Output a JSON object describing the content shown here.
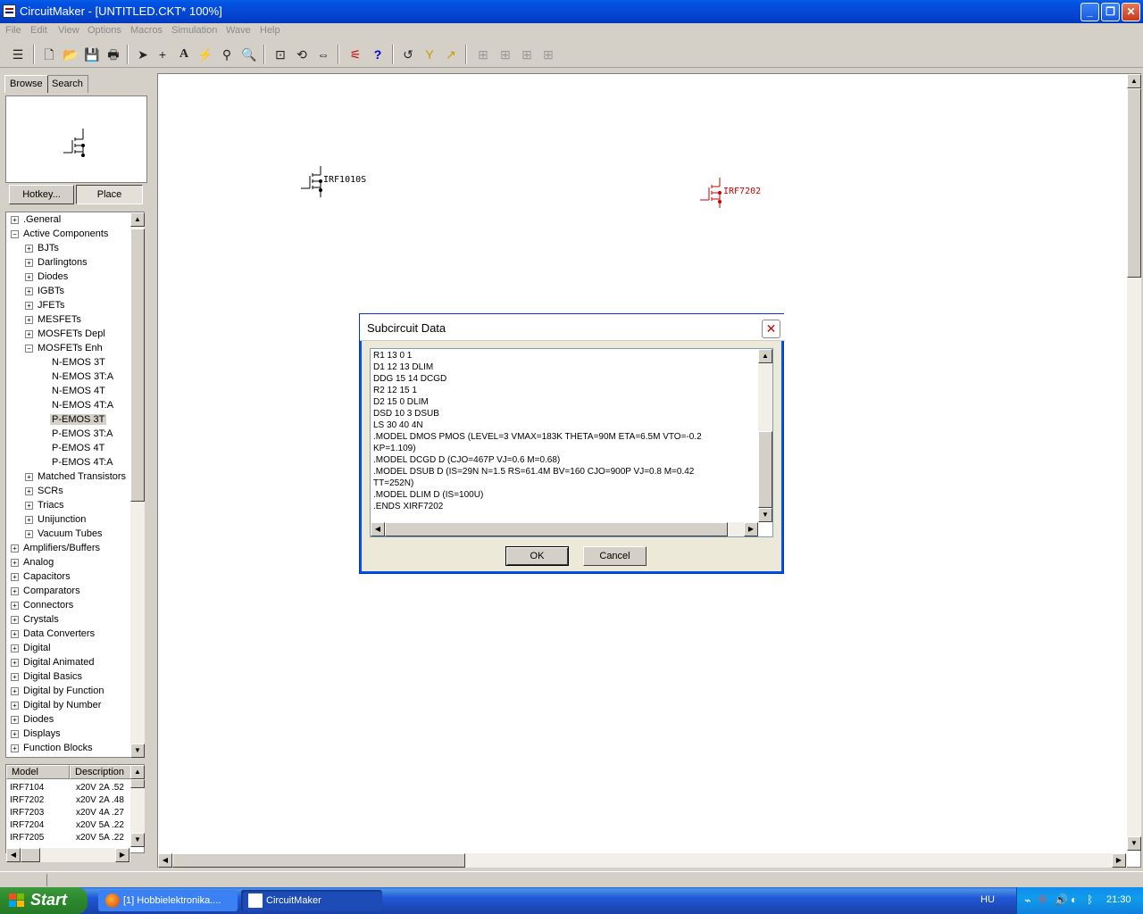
{
  "window": {
    "title": "CircuitMaker - [UNTITLED.CKT* 100%]"
  },
  "menu": [
    "File",
    "Edit",
    "View",
    "Options",
    "Macros",
    "Simulation",
    "Wave",
    "Help"
  ],
  "tabs": {
    "browse": "Browse",
    "search": "Search"
  },
  "buttons": {
    "hotkey": "Hotkey...",
    "place": "Place"
  },
  "tree": [
    {
      "label": ".General",
      "level": 0,
      "exp": "+"
    },
    {
      "label": "Active Components",
      "level": 0,
      "exp": "−"
    },
    {
      "label": "BJTs",
      "level": 1,
      "exp": "+"
    },
    {
      "label": "Darlingtons",
      "level": 1,
      "exp": "+"
    },
    {
      "label": "Diodes",
      "level": 1,
      "exp": "+"
    },
    {
      "label": "IGBTs",
      "level": 1,
      "exp": "+"
    },
    {
      "label": "JFETs",
      "level": 1,
      "exp": "+"
    },
    {
      "label": "MESFETs",
      "level": 1,
      "exp": "+"
    },
    {
      "label": "MOSFETs Depl",
      "level": 1,
      "exp": "+"
    },
    {
      "label": "MOSFETs Enh",
      "level": 1,
      "exp": "−"
    },
    {
      "label": "N-EMOS 3T",
      "level": 2,
      "exp": ""
    },
    {
      "label": "N-EMOS 3T:A",
      "level": 2,
      "exp": ""
    },
    {
      "label": "N-EMOS 4T",
      "level": 2,
      "exp": ""
    },
    {
      "label": "N-EMOS 4T:A",
      "level": 2,
      "exp": ""
    },
    {
      "label": "P-EMOS 3T",
      "level": 2,
      "exp": "",
      "selected": true
    },
    {
      "label": "P-EMOS 3T:A",
      "level": 2,
      "exp": ""
    },
    {
      "label": "P-EMOS 4T",
      "level": 2,
      "exp": ""
    },
    {
      "label": "P-EMOS 4T:A",
      "level": 2,
      "exp": ""
    },
    {
      "label": "Matched Transistors",
      "level": 1,
      "exp": "+"
    },
    {
      "label": "SCRs",
      "level": 1,
      "exp": "+"
    },
    {
      "label": "Triacs",
      "level": 1,
      "exp": "+"
    },
    {
      "label": "Unijunction",
      "level": 1,
      "exp": "+"
    },
    {
      "label": "Vacuum Tubes",
      "level": 1,
      "exp": "+"
    },
    {
      "label": "Amplifiers/Buffers",
      "level": 0,
      "exp": "+"
    },
    {
      "label": "Analog",
      "level": 0,
      "exp": "+"
    },
    {
      "label": "Capacitors",
      "level": 0,
      "exp": "+"
    },
    {
      "label": "Comparators",
      "level": 0,
      "exp": "+"
    },
    {
      "label": "Connectors",
      "level": 0,
      "exp": "+"
    },
    {
      "label": "Crystals",
      "level": 0,
      "exp": "+"
    },
    {
      "label": "Data Converters",
      "level": 0,
      "exp": "+"
    },
    {
      "label": "Digital",
      "level": 0,
      "exp": "+"
    },
    {
      "label": "Digital Animated",
      "level": 0,
      "exp": "+"
    },
    {
      "label": "Digital Basics",
      "level": 0,
      "exp": "+"
    },
    {
      "label": "Digital by Function",
      "level": 0,
      "exp": "+"
    },
    {
      "label": "Digital by Number",
      "level": 0,
      "exp": "+"
    },
    {
      "label": "Diodes",
      "level": 0,
      "exp": "+"
    },
    {
      "label": "Displays",
      "level": 0,
      "exp": "+"
    },
    {
      "label": "Function Blocks",
      "level": 0,
      "exp": "+"
    }
  ],
  "model_table": {
    "headers": [
      "Model",
      "Description"
    ],
    "rows": [
      [
        "IRF7104",
        "x20V 2A .52"
      ],
      [
        "IRF7202",
        "x20V 2A .48"
      ],
      [
        "IRF7203",
        "x20V 4A .27"
      ],
      [
        "IRF7204",
        "x20V 5A .22"
      ],
      [
        "IRF7205",
        "x20V 5A .22"
      ]
    ]
  },
  "canvas": {
    "components": [
      {
        "label": "IRF1010S",
        "color": "#000000"
      },
      {
        "label": "IRF7202",
        "color": "#cc0000"
      }
    ]
  },
  "dialog": {
    "title": "Subcircuit Data",
    "lines": [
      "R1  13  0  1",
      "D1  12 13  DLIM",
      "DDG 15 14  DCGD",
      "R2  12 15  1",
      "D2  15  0  DLIM",
      "DSD 10  3  DSUB",
      "LS  30 40  4N",
      ".MODEL DMOS PMOS (LEVEL=3 VMAX=183K THETA=90M ETA=6.5M VTO=-0.2",
      "KP=1.109)",
      ".MODEL DCGD D (CJO=467P VJ=0.6 M=0.68)",
      ".MODEL DSUB D (IS=29N N=1.5 RS=61.4M BV=160 CJO=900P VJ=0.8 M=0.42",
      "TT=252N)",
      ".MODEL DLIM D (IS=100U)",
      ".ENDS XIRF7202"
    ],
    "ok": "OK",
    "cancel": "Cancel"
  },
  "taskbar": {
    "start": "Start",
    "tasks": [
      "[1] Hobbielektronika....",
      "CircuitMaker"
    ],
    "language": "HU",
    "clock": "21:30"
  }
}
